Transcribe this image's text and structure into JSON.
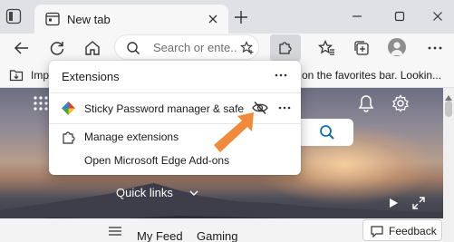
{
  "tab": {
    "title": "New tab"
  },
  "addressbar": {
    "placeholder": "Search or ente..."
  },
  "favorites_bar": {
    "import_label": "Impo",
    "message": "on the favorites bar. Lookin..."
  },
  "extensions_popup": {
    "title": "Extensions",
    "items": [
      {
        "name": "Sticky Password manager & safe",
        "icon": "sticky-password-icon"
      }
    ],
    "manage_label": "Manage extensions",
    "addons_label": "Open Microsoft Edge Add-ons"
  },
  "ntp": {
    "quicklinks_label": "Quick links",
    "nav": {
      "myfeed": "My Feed",
      "gaming": "Gaming"
    },
    "feedback_label": "Feedback"
  },
  "colors": {
    "accent": "#0f6cbd",
    "arrow": "#f28a3c"
  }
}
